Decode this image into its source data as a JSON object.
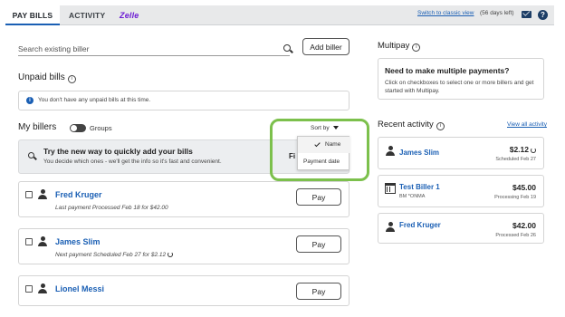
{
  "nav": {
    "tabs": [
      "PAY BILLS",
      "ACTIVITY"
    ],
    "zelle": "Zelle",
    "classic_link": "Switch to classic view",
    "days_left": "(56 days left)",
    "help": "?"
  },
  "search": {
    "placeholder": "Search existing biller",
    "add_biller": "Add biller"
  },
  "unpaid": {
    "title": "Unpaid bills",
    "info": "i",
    "message": "You don't have any unpaid bills at this time."
  },
  "my_billers": {
    "title": "My billers",
    "groups": "Groups",
    "sort_by": "Sort by",
    "sort_options": [
      "Name",
      "Payment date"
    ],
    "promo_title": "Try the new way to quickly add your bills",
    "promo_sub": "You decide which ones - we'll get the info so it's fast and convenient.",
    "promo_find": "Fi",
    "billers": [
      {
        "name": "Fred Kruger",
        "detail": "Last payment Processed Feb 18 for $42.00",
        "pay": "Pay"
      },
      {
        "name": "James Slim",
        "detail": "Next payment Scheduled Feb 27 for $2.12",
        "pay": "Pay"
      },
      {
        "name": "Lionel Messi",
        "detail": "",
        "pay": "Pay"
      }
    ]
  },
  "multipay": {
    "title": "Multipay",
    "heading": "Need to make multiple payments?",
    "text": "Click on checkboxes to select one or more billers and get started with Multipay."
  },
  "recent": {
    "title": "Recent activity",
    "view_all": "View all activity",
    "items": [
      {
        "name": "James Slim",
        "sub": "",
        "amount": "$2.12",
        "status": "Scheduled Feb 27"
      },
      {
        "name": "Test Biller 1",
        "sub": "BM *ONMA",
        "amount": "$45.00",
        "status": "Processing Feb 19"
      },
      {
        "name": "Fred Kruger",
        "sub": "",
        "amount": "$42.00",
        "status": "Processed Feb 26"
      }
    ]
  },
  "colors": {
    "accent": "#1a5fb4",
    "zelle": "#6d1ed4",
    "highlight": "#7cc04c"
  }
}
